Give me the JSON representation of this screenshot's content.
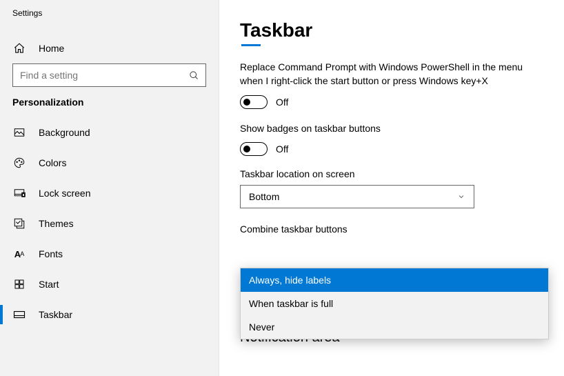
{
  "app_title": "Settings",
  "home_label": "Home",
  "search": {
    "placeholder": "Find a setting"
  },
  "section_label": "Personalization",
  "sidebar": {
    "items": [
      {
        "label": "Background"
      },
      {
        "label": "Colors"
      },
      {
        "label": "Lock screen"
      },
      {
        "label": "Themes"
      },
      {
        "label": "Fonts"
      },
      {
        "label": "Start"
      },
      {
        "label": "Taskbar"
      }
    ]
  },
  "page_title": "Taskbar",
  "settings": {
    "powershell": {
      "text": "Replace Command Prompt with Windows PowerShell in the menu when I right-click the start button or press Windows key+X",
      "state": "Off"
    },
    "badges": {
      "text": "Show badges on taskbar buttons",
      "state": "Off"
    },
    "location": {
      "label": "Taskbar location on screen",
      "value": "Bottom"
    },
    "combine": {
      "label": "Combine taskbar buttons",
      "options": [
        "Always, hide labels",
        "When taskbar is full",
        "Never"
      ]
    }
  },
  "next_section": "Notification area"
}
